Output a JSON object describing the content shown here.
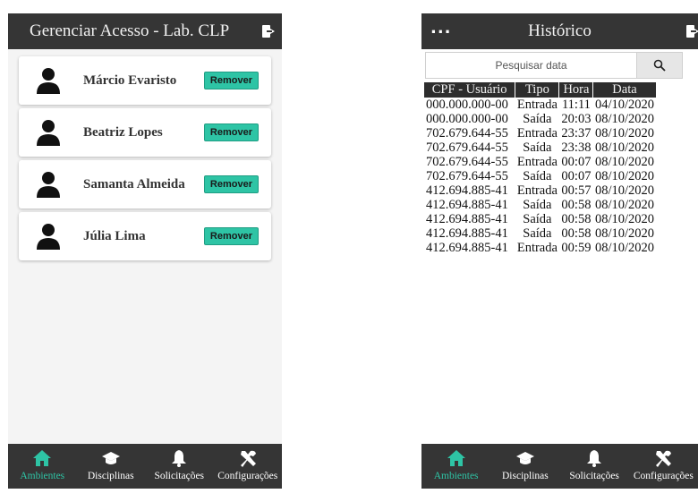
{
  "left_screen": {
    "title": "Gerenciar Acesso - Lab. CLP",
    "exit_icon": "exit-door-icon",
    "users": [
      {
        "name": "Márcio Evaristo",
        "button": "Remover"
      },
      {
        "name": "Beatriz Lopes",
        "button": "Remover"
      },
      {
        "name": "Samanta Almeida",
        "button": "Remover"
      },
      {
        "name": "Júlia Lima",
        "button": "Remover"
      }
    ],
    "nav": [
      {
        "label": "Ambientes",
        "icon": "home-icon",
        "active": true
      },
      {
        "label": "Disciplinas",
        "icon": "graduation-cap-icon",
        "active": false
      },
      {
        "label": "Solicitações",
        "icon": "bell-icon",
        "active": false
      },
      {
        "label": "Configurações",
        "icon": "tools-icon",
        "active": false
      }
    ]
  },
  "right_screen": {
    "menu": "...",
    "title": "Histórico",
    "search": {
      "placeholder": "Pesquisar data"
    },
    "table": {
      "headers": [
        "CPF - Usuário",
        "Tipo",
        "Hora",
        "Data"
      ],
      "rows": [
        [
          "000.000.000-00",
          "Entrada",
          "11:11",
          "04/10/2020"
        ],
        [
          "000.000.000-00",
          "Saída",
          "20:03",
          "08/10/2020"
        ],
        [
          "702.679.644-55",
          "Entrada",
          "23:37",
          "08/10/2020"
        ],
        [
          "702.679.644-55",
          "Saída",
          "23:38",
          "08/10/2020"
        ],
        [
          "702.679.644-55",
          "Entrada",
          "00:07",
          "08/10/2020"
        ],
        [
          "702.679.644-55",
          "Saída",
          "00:07",
          "08/10/2020"
        ],
        [
          "412.694.885-41",
          "Entrada",
          "00:57",
          "08/10/2020"
        ],
        [
          "412.694.885-41",
          "Saída",
          "00:58",
          "08/10/2020"
        ],
        [
          "412.694.885-41",
          "Saída",
          "00:58",
          "08/10/2020"
        ],
        [
          "412.694.885-41",
          "Saída",
          "00:58",
          "08/10/2020"
        ],
        [
          "412.694.885-41",
          "Entrada",
          "00:59",
          "08/10/2020"
        ]
      ]
    },
    "nav": [
      {
        "label": "Ambientes",
        "icon": "home-icon",
        "active": true
      },
      {
        "label": "Disciplinas",
        "icon": "graduation-cap-icon",
        "active": false
      },
      {
        "label": "Solicitações",
        "icon": "bell-icon",
        "active": false
      },
      {
        "label": "Configurações",
        "icon": "tools-icon",
        "active": false
      }
    ]
  },
  "colors": {
    "appbar": "#353535",
    "accent": "#2ec4a5",
    "table_header": "#2d2d2d"
  }
}
